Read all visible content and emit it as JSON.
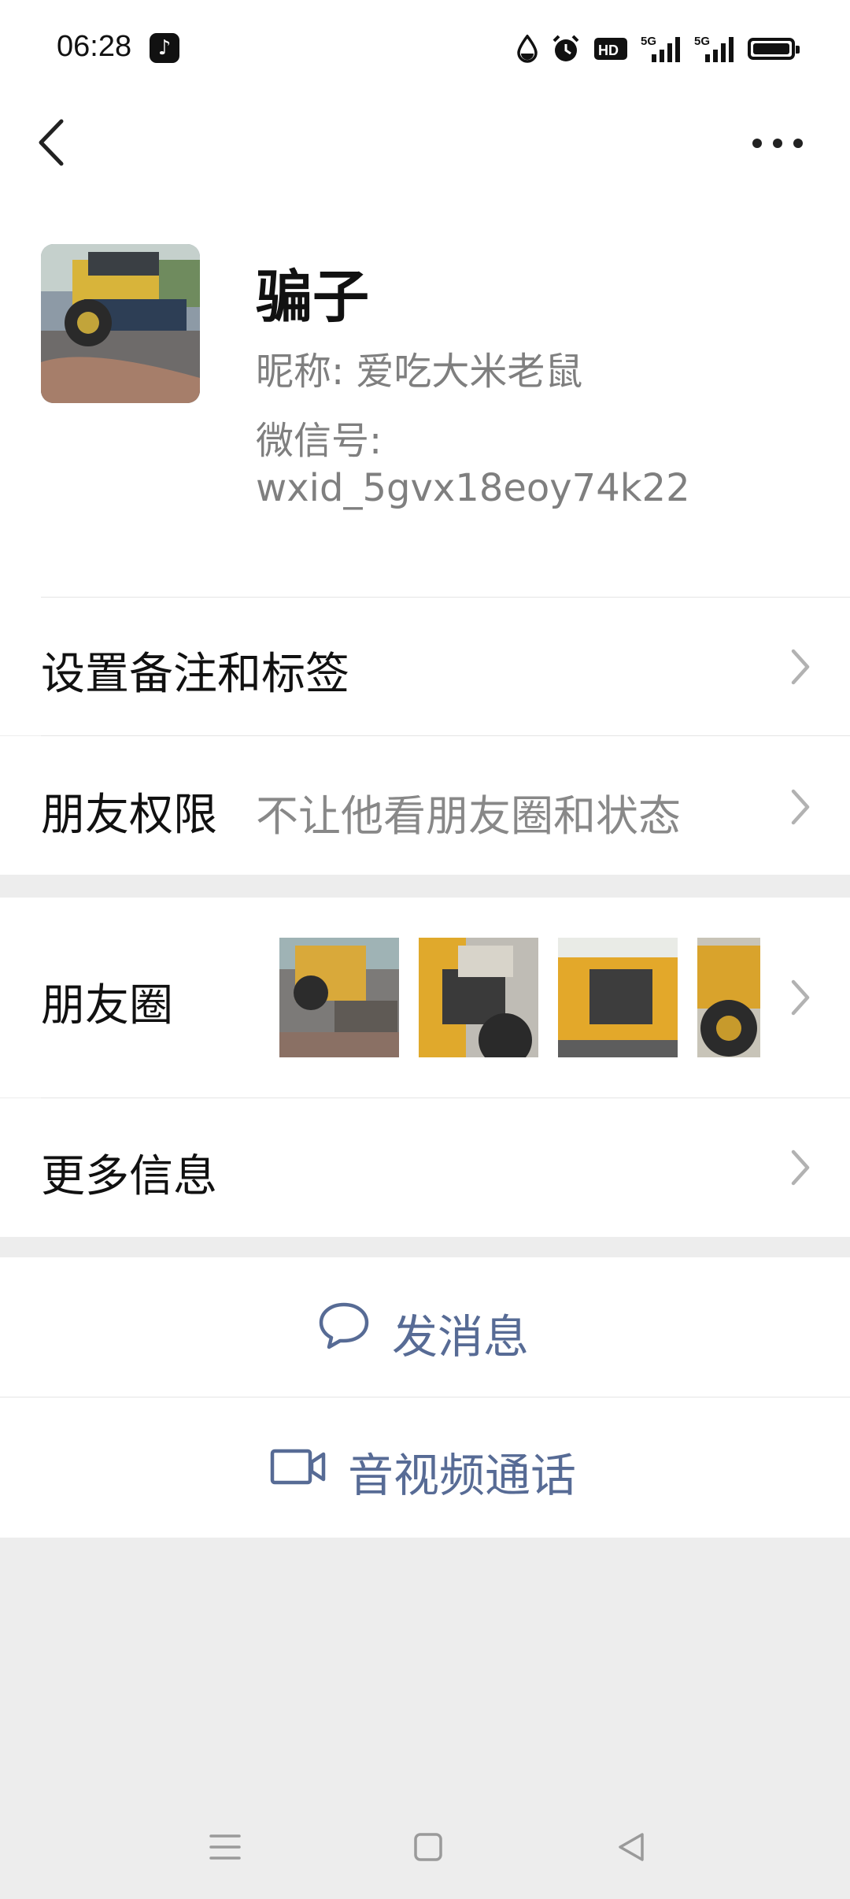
{
  "status_bar": {
    "time": "06:28",
    "app_badge": "tiktok-logo",
    "icons": [
      "water-drop-icon",
      "alarm-icon",
      "hd-icon",
      "signal-5g-icon",
      "signal-5g-icon",
      "battery-icon"
    ]
  },
  "header": {
    "back_icon": "chevron-left-icon",
    "more_icon": "more-dots-icon"
  },
  "profile": {
    "display_name": "骗子",
    "nickname": "昵称: 爱吃大米老鼠",
    "wechat_id_label": "微信号:",
    "wechat_id": "wxid_5gvx18eoy74k22",
    "avatar": "avatar-image (yellow wheel loader)"
  },
  "settings": {
    "remarks_tags": "设置备注和标签",
    "friend_permissions_label": "朋友权限",
    "friend_permissions_value": "不让他看朋友圈和状态"
  },
  "moments": {
    "label": "朋友圈",
    "thumbnails": [
      "moments-photo-1",
      "moments-photo-2",
      "moments-photo-3",
      "moments-photo-4"
    ]
  },
  "more_info": {
    "label": "更多信息"
  },
  "actions": {
    "send_message": "发消息",
    "av_call": "音视频通话"
  },
  "colors": {
    "link_blue": "#576b95",
    "background": "#ededed",
    "card": "#ffffff",
    "secondary_text": "#7f7f7f"
  }
}
